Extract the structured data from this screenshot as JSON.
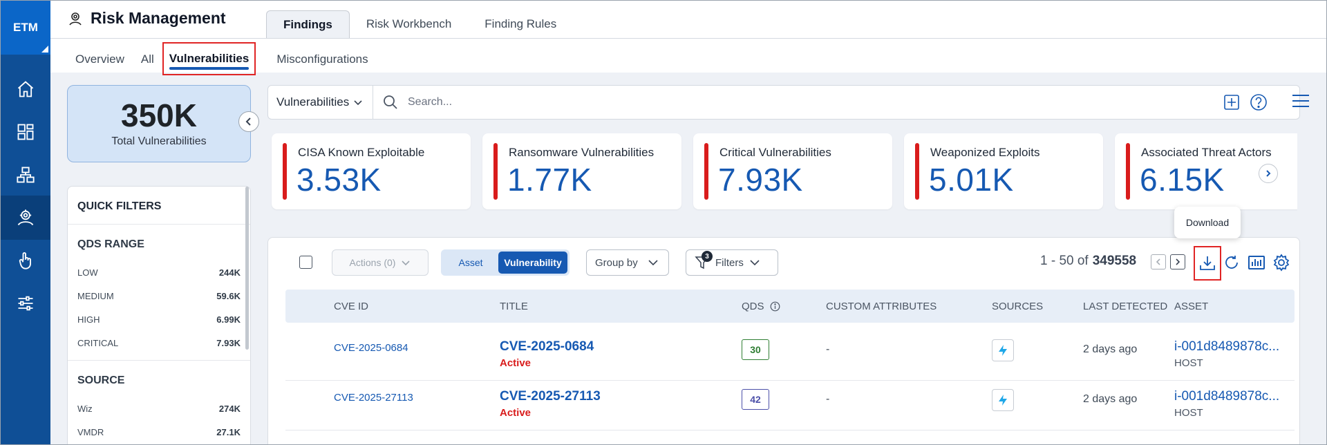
{
  "sidebar": {
    "brand": "ETM"
  },
  "header": {
    "title": "Risk Management",
    "tabs": [
      {
        "label": "Findings"
      },
      {
        "label": "Risk Workbench"
      },
      {
        "label": "Finding Rules"
      }
    ],
    "subtabs": [
      {
        "label": "Overview"
      },
      {
        "label": "All"
      },
      {
        "label": "Vulnerabilities"
      },
      {
        "label": "Misconfigurations"
      }
    ]
  },
  "summary": {
    "value": "350K",
    "label": "Total Vulnerabilities"
  },
  "quick_filters": {
    "title": "QUICK FILTERS",
    "qds_range": {
      "title": "QDS RANGE",
      "rows": [
        {
          "label": "LOW",
          "value": "244K"
        },
        {
          "label": "MEDIUM",
          "value": "59.6K"
        },
        {
          "label": "HIGH",
          "value": "6.99K"
        },
        {
          "label": "CRITICAL",
          "value": "7.93K"
        }
      ]
    },
    "source": {
      "title": "SOURCE",
      "rows": [
        {
          "label": "Wiz",
          "value": "274K"
        },
        {
          "label": "VMDR",
          "value": "27.1K"
        }
      ]
    }
  },
  "search": {
    "dropdown": "Vulnerabilities",
    "placeholder": "Search..."
  },
  "stats": [
    {
      "title": "CISA Known Exploitable",
      "value": "3.53K"
    },
    {
      "title": "Ransomware Vulnerabilities",
      "value": "1.77K"
    },
    {
      "title": "Critical Vulnerabilities",
      "value": "7.93K"
    },
    {
      "title": "Weaponized Exploits",
      "value": "5.01K"
    },
    {
      "title": "Associated Threat Actors",
      "value": "6.15K"
    }
  ],
  "toolbar": {
    "actions": "Actions (0)",
    "toggle_asset": "Asset",
    "toggle_vuln": "Vulnerability",
    "group_by": "Group by",
    "filters": "Filters",
    "filter_count": "3",
    "range": "1 - 50 of",
    "total": "349558",
    "tooltip": "Download"
  },
  "table": {
    "headers": {
      "cve": "CVE ID",
      "title": "TITLE",
      "qds": "QDS",
      "custom": "CUSTOM ATTRIBUTES",
      "sources": "SOURCES",
      "last": "LAST DETECTED",
      "asset": "ASSET"
    },
    "rows": [
      {
        "cve": "CVE-2025-0684",
        "title": "CVE-2025-0684",
        "status": "Active",
        "qds": "30",
        "qds_color": "#2e7d32",
        "custom": "-",
        "last": "2 days ago",
        "asset": "i-001d8489878c...",
        "asset_type": "HOST"
      },
      {
        "cve": "CVE-2025-27113",
        "title": "CVE-2025-27113",
        "status": "Active",
        "qds": "42",
        "qds_color": "#4b4fa8",
        "custom": "-",
        "last": "2 days ago",
        "asset": "i-001d8489878c...",
        "asset_type": "HOST"
      }
    ]
  }
}
